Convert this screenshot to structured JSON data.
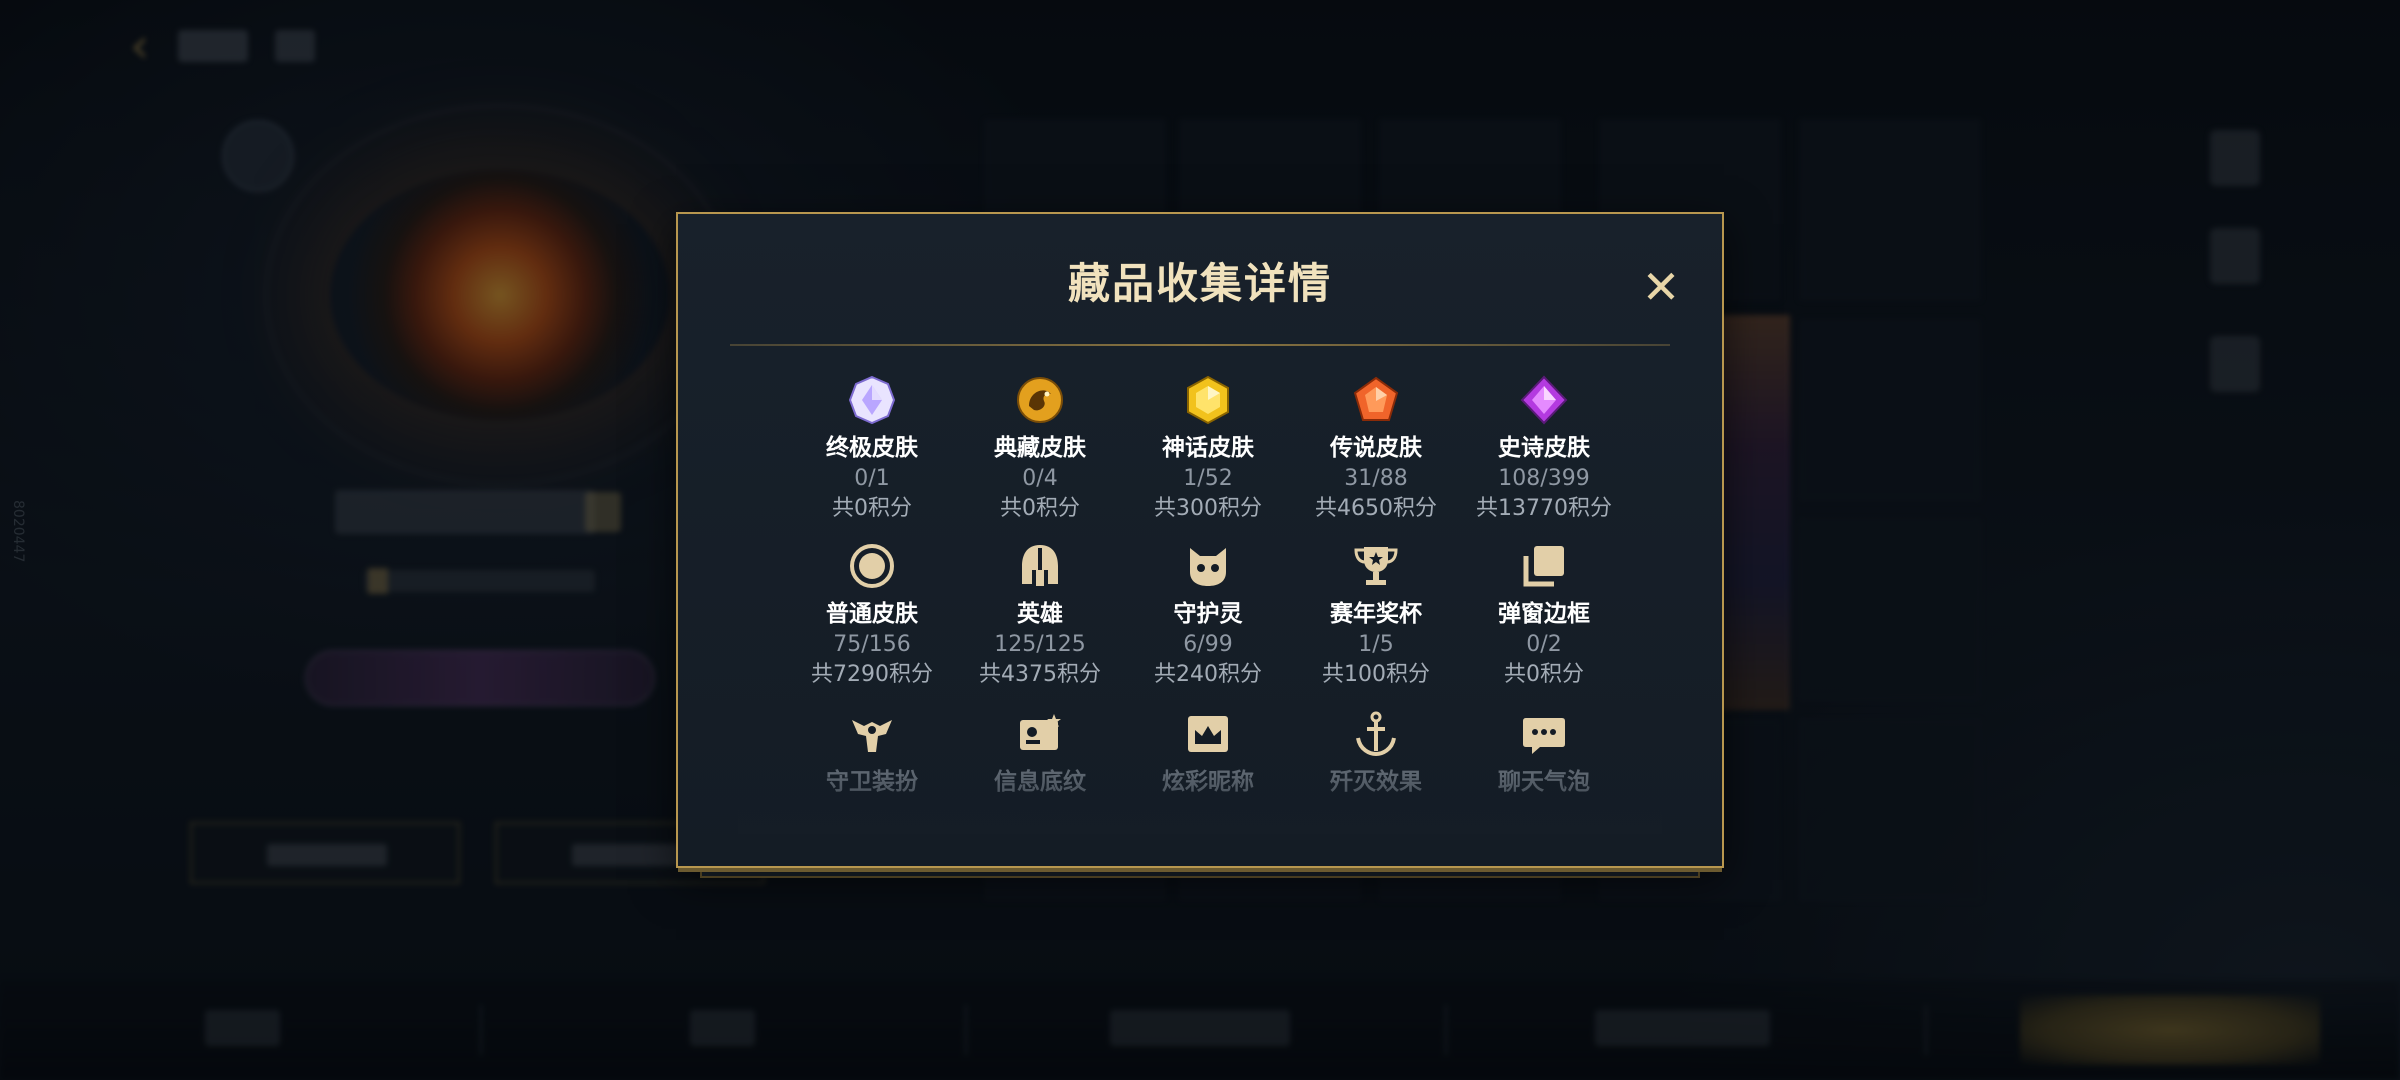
{
  "background": {
    "side_code": "8020447"
  },
  "modal": {
    "title": "藏品收集详情",
    "close_symbol": "✕",
    "rows": [
      [
        {
          "icon": "ultimate-skin-icon",
          "name": "终极皮肤",
          "count": "0/1",
          "points": "共0积分",
          "color": "#b9a6ff"
        },
        {
          "icon": "collector-skin-icon",
          "name": "典藏皮肤",
          "count": "0/4",
          "points": "共0积分",
          "color": "#e3a01e"
        },
        {
          "icon": "mythic-skin-icon",
          "name": "神话皮肤",
          "count": "1/52",
          "points": "共300积分",
          "color": "#f2c21c"
        },
        {
          "icon": "legendary-skin-icon",
          "name": "传说皮肤",
          "count": "31/88",
          "points": "共4650积分",
          "color": "#f0642a"
        },
        {
          "icon": "epic-skin-icon",
          "name": "史诗皮肤",
          "count": "108/399",
          "points": "共13770积分",
          "color": "#b43ae0"
        }
      ],
      [
        {
          "icon": "normal-skin-icon",
          "name": "普通皮肤",
          "count": "75/156",
          "points": "共7290积分",
          "color": "#e2cfa8"
        },
        {
          "icon": "hero-helmet-icon",
          "name": "英雄",
          "count": "125/125",
          "points": "共4375积分",
          "color": "#e2cfa8"
        },
        {
          "icon": "guardian-spirit-icon",
          "name": "守护灵",
          "count": "6/99",
          "points": "共240积分",
          "color": "#e2cfa8"
        },
        {
          "icon": "trophy-icon",
          "name": "赛年奖杯",
          "count": "1/5",
          "points": "共100积分",
          "color": "#e2cfa8"
        },
        {
          "icon": "popup-frame-icon",
          "name": "弹窗边框",
          "count": "0/2",
          "points": "共0积分",
          "color": "#e2cfa8"
        }
      ],
      [
        {
          "icon": "guard-outfit-icon",
          "name": "守卫装扮",
          "color": "#e2cfa8"
        },
        {
          "icon": "info-card-icon",
          "name": "信息底纹",
          "color": "#e2cfa8"
        },
        {
          "icon": "fancy-nickname-icon",
          "name": "炫彩昵称",
          "color": "#e2cfa8"
        },
        {
          "icon": "annihilation-effect-icon",
          "name": "歼灭效果",
          "color": "#e2cfa8"
        },
        {
          "icon": "chat-bubble-icon",
          "name": "聊天气泡",
          "color": "#e2cfa8"
        }
      ]
    ]
  },
  "colors": {
    "accent_gold": "#b8974f",
    "title": "#f1e2bd"
  }
}
